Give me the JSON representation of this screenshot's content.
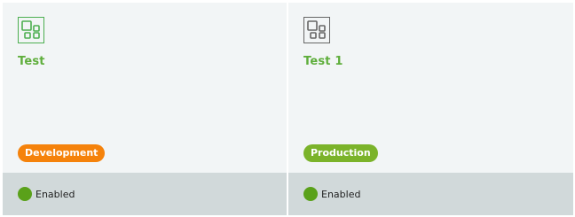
{
  "colors": {
    "active_accent": "#4caf50",
    "inactive_icon": "#666666",
    "title_green": "#5fae3c",
    "card_bg": "#f2f5f6",
    "footer_bg": "#d1d9da",
    "enabled_dot": "#5aa11a"
  },
  "cards": [
    {
      "title": "Test",
      "icon": "app-grid-icon",
      "icon_color": "#4caf50",
      "environment": "Development",
      "environment_color": "#f5820b",
      "status": "Enabled"
    },
    {
      "title": "Test 1",
      "icon": "app-grid-icon",
      "icon_color": "#666666",
      "environment": "Production",
      "environment_color": "#7bb32a",
      "status": "Enabled"
    }
  ]
}
